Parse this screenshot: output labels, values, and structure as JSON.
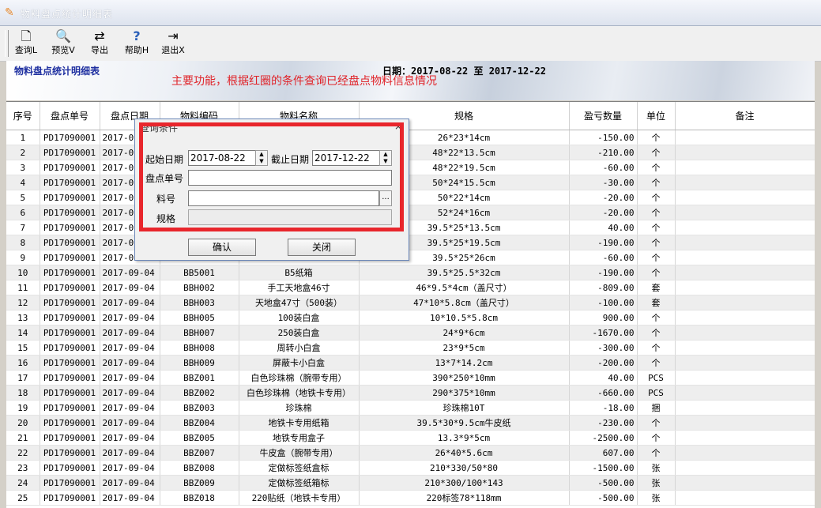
{
  "window": {
    "title": "物料盘点统计明细表"
  },
  "toolbar": [
    {
      "label": "查询L",
      "icon": "document-search-icon",
      "glyph": "🗋"
    },
    {
      "label": "预览V",
      "icon": "magnifier-icon",
      "glyph": "🔍"
    },
    {
      "label": "导出",
      "icon": "export-icon",
      "glyph": "⇄"
    },
    {
      "label": "帮助H",
      "icon": "help-icon",
      "glyph": "?"
    },
    {
      "label": "退出X",
      "icon": "exit-icon",
      "glyph": "⇥"
    }
  ],
  "report": {
    "title": "物料盘点统计明细表",
    "annotation": "主要功能，根据红圈的条件查询已经盘点物料信息情况",
    "date_label": "日期：2017-08-22  至  2017-12-22"
  },
  "table": {
    "columns": [
      "序号",
      "盘点单号",
      "盘点日期",
      "物料编码",
      "物料名称",
      "规格",
      "盈亏数量",
      "单位",
      "备注"
    ],
    "rows": [
      [
        "1",
        "PD17090001",
        "2017-09",
        "",
        "",
        "26*23*14cm",
        "-150.00",
        "个",
        ""
      ],
      [
        "2",
        "PD17090001",
        "2017-09",
        "",
        "",
        "48*22*13.5cm",
        "-210.00",
        "个",
        ""
      ],
      [
        "3",
        "PD17090001",
        "2017-09",
        "",
        "",
        "48*22*19.5cm",
        "-60.00",
        "个",
        ""
      ],
      [
        "4",
        "PD17090001",
        "2017-09",
        "",
        "",
        "50*24*15.5cm",
        "-30.00",
        "个",
        ""
      ],
      [
        "5",
        "PD17090001",
        "2017-09",
        "",
        "",
        "50*22*14cm",
        "-20.00",
        "个",
        ""
      ],
      [
        "6",
        "PD17090001",
        "2017-09",
        "",
        "",
        "52*24*16cm",
        "-20.00",
        "个",
        ""
      ],
      [
        "7",
        "PD17090001",
        "2017-09",
        "",
        "",
        "39.5*25*13.5cm",
        "40.00",
        "个",
        ""
      ],
      [
        "8",
        "PD17090001",
        "2017-09",
        "",
        "",
        "39.5*25*19.5cm",
        "-190.00",
        "个",
        ""
      ],
      [
        "9",
        "PD17090001",
        "2017-09",
        "",
        "",
        "39.5*25*26cm",
        "-60.00",
        "个",
        ""
      ],
      [
        "10",
        "PD17090001",
        "2017-09-04",
        "BB5001",
        "B5纸箱",
        "39.5*25.5*32cm",
        "-190.00",
        "个",
        ""
      ],
      [
        "11",
        "PD17090001",
        "2017-09-04",
        "BBH002",
        "手工天地盒46寸",
        "46*9.5*4cm（盖尺寸）",
        "-809.00",
        "套",
        ""
      ],
      [
        "12",
        "PD17090001",
        "2017-09-04",
        "BBH003",
        "天地盒47寸（500装）",
        "47*10*5.8cm（盖尺寸）",
        "-100.00",
        "套",
        ""
      ],
      [
        "13",
        "PD17090001",
        "2017-09-04",
        "BBH005",
        "100装白盒",
        "10*10.5*5.8cm",
        "900.00",
        "个",
        ""
      ],
      [
        "14",
        "PD17090001",
        "2017-09-04",
        "BBH007",
        "250装白盒",
        "24*9*6cm",
        "-1670.00",
        "个",
        ""
      ],
      [
        "15",
        "PD17090001",
        "2017-09-04",
        "BBH008",
        "周转小白盒",
        "23*9*5cm",
        "-300.00",
        "个",
        ""
      ],
      [
        "16",
        "PD17090001",
        "2017-09-04",
        "BBH009",
        "屏蔽卡小白盒",
        "13*7*14.2cm",
        "-200.00",
        "个",
        ""
      ],
      [
        "17",
        "PD17090001",
        "2017-09-04",
        "BBZ001",
        "白色珍珠棉（腕带专用）",
        "390*250*10mm",
        "40.00",
        "PCS",
        ""
      ],
      [
        "18",
        "PD17090001",
        "2017-09-04",
        "BBZ002",
        "白色珍珠棉（地铁卡专用）",
        "290*375*10mm",
        "-660.00",
        "PCS",
        ""
      ],
      [
        "19",
        "PD17090001",
        "2017-09-04",
        "BBZ003",
        "珍珠棉",
        "珍珠棉10T",
        "-18.00",
        "捆",
        ""
      ],
      [
        "20",
        "PD17090001",
        "2017-09-04",
        "BBZ004",
        "地铁卡专用纸箱",
        "39.5*30*9.5cm牛皮纸",
        "-230.00",
        "个",
        ""
      ],
      [
        "21",
        "PD17090001",
        "2017-09-04",
        "BBZ005",
        "地铁专用盒子",
        "13.3*9*5cm",
        "-2500.00",
        "个",
        ""
      ],
      [
        "22",
        "PD17090001",
        "2017-09-04",
        "BBZ007",
        "牛皮盒（腕带专用）",
        "26*40*5.6cm",
        "607.00",
        "个",
        ""
      ],
      [
        "23",
        "PD17090001",
        "2017-09-04",
        "BBZ008",
        "定做标签纸盒标",
        "210*330/50*80",
        "-1500.00",
        "张",
        ""
      ],
      [
        "24",
        "PD17090001",
        "2017-09-04",
        "BBZ009",
        "定做标签纸箱标",
        "210*300/100*143",
        "-500.00",
        "张",
        ""
      ],
      [
        "25",
        "PD17090001",
        "2017-09-04",
        "BBZ018",
        "220贴纸（地铁卡专用）",
        "220标签78*118mm",
        "-500.00",
        "张",
        ""
      ]
    ]
  },
  "dialog": {
    "title": "查询条件",
    "close_glyph": "×",
    "start_date_label": "起始日期",
    "start_date_value": "2017-08-22",
    "end_date_label": "截止日期",
    "end_date_value": "2017-12-22",
    "order_no_label": "盘点单号",
    "order_no_value": "",
    "material_label": "料号",
    "material_value": "",
    "browse_glyph": "...",
    "spec_label": "规格",
    "spec_value": "",
    "confirm_label": "确认",
    "close_label": "关闭"
  },
  "colors": {
    "annotation": "#e0242a",
    "report_title": "#1e2fa0",
    "highlight_box": "#e8262c"
  }
}
